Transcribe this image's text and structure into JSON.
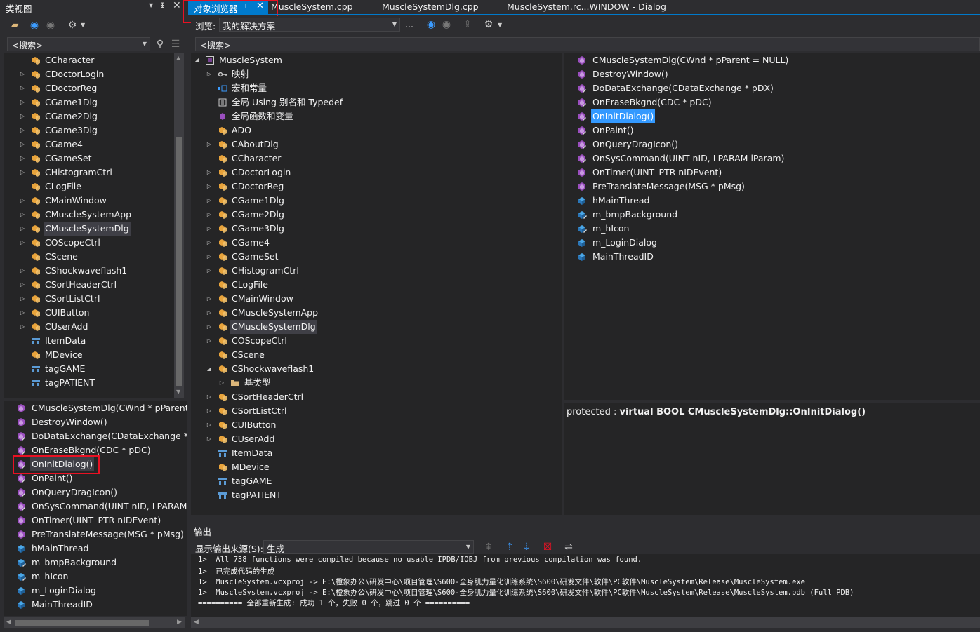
{
  "left": {
    "title": "类视图",
    "search_placeholder": "<搜索>",
    "classes": [
      {
        "label": "CCharacter",
        "icon": "class-icon",
        "arrow": false
      },
      {
        "label": "CDoctorLogin",
        "icon": "class-icon",
        "arrow": true
      },
      {
        "label": "CDoctorReg",
        "icon": "class-icon",
        "arrow": true
      },
      {
        "label": "CGame1Dlg",
        "icon": "class-icon",
        "arrow": true
      },
      {
        "label": "CGame2Dlg",
        "icon": "class-icon",
        "arrow": true
      },
      {
        "label": "CGame3Dlg",
        "icon": "class-icon",
        "arrow": true
      },
      {
        "label": "CGame4",
        "icon": "class-icon",
        "arrow": true
      },
      {
        "label": "CGameSet",
        "icon": "class-icon",
        "arrow": true
      },
      {
        "label": "CHistogramCtrl",
        "icon": "class-icon",
        "arrow": true
      },
      {
        "label": "CLogFile",
        "icon": "class-icon",
        "arrow": false
      },
      {
        "label": "CMainWindow",
        "icon": "class-icon",
        "arrow": true
      },
      {
        "label": "CMuscleSystemApp",
        "icon": "class-icon",
        "arrow": true
      },
      {
        "label": "CMuscleSystemDlg",
        "icon": "class-icon",
        "arrow": true,
        "selected": true
      },
      {
        "label": "COScopeCtrl",
        "icon": "class-icon",
        "arrow": true
      },
      {
        "label": "CScene",
        "icon": "class-icon",
        "arrow": false
      },
      {
        "label": "CShockwaveflash1",
        "icon": "class-icon",
        "arrow": true
      },
      {
        "label": "CSortHeaderCtrl",
        "icon": "class-icon",
        "arrow": true
      },
      {
        "label": "CSortListCtrl",
        "icon": "class-icon",
        "arrow": true
      },
      {
        "label": "CUIButton",
        "icon": "class-icon",
        "arrow": true
      },
      {
        "label": "CUserAdd",
        "icon": "class-icon",
        "arrow": true
      },
      {
        "label": "ItemData",
        "icon": "struct-icon",
        "arrow": false
      },
      {
        "label": "MDevice",
        "icon": "class-icon",
        "arrow": false
      },
      {
        "label": "tagGAME",
        "icon": "struct-icon",
        "arrow": false
      },
      {
        "label": "tagPATIENT",
        "icon": "struct-icon",
        "arrow": false
      }
    ],
    "members": [
      {
        "label": "CMuscleSystemDlg(CWnd * pParent = NULL)",
        "icon": "method-public-icon"
      },
      {
        "label": "DestroyWindow()",
        "icon": "method-public-icon"
      },
      {
        "label": "DoDataExchange(CDataExchange * pDX)",
        "icon": "method-protected-icon"
      },
      {
        "label": "OnEraseBkgnd(CDC * pDC)",
        "icon": "method-protected-icon"
      },
      {
        "label": "OnInitDialog()",
        "icon": "method-protected-icon",
        "selected": true
      },
      {
        "label": "OnPaint()",
        "icon": "method-protected-icon"
      },
      {
        "label": "OnQueryDragIcon()",
        "icon": "method-protected-icon"
      },
      {
        "label": "OnSysCommand(UINT nID, LPARAM lParam)",
        "icon": "method-protected-icon"
      },
      {
        "label": "OnTimer(UINT_PTR nIDEvent)",
        "icon": "method-public-icon"
      },
      {
        "label": "PreTranslateMessage(MSG * pMsg)",
        "icon": "method-public-icon"
      },
      {
        "label": "hMainThread",
        "icon": "field-icon"
      },
      {
        "label": "m_bmpBackground",
        "icon": "field-protected-icon"
      },
      {
        "label": "m_hIcon",
        "icon": "field-protected-icon"
      },
      {
        "label": "m_LoginDialog",
        "icon": "field-icon"
      },
      {
        "label": "MainThreadID",
        "icon": "field-icon"
      }
    ]
  },
  "tabs": [
    {
      "label": "对象浏览器",
      "active": true
    },
    {
      "label": "MuscleSystem.cpp"
    },
    {
      "label": "MuscleSystemDlg.cpp"
    },
    {
      "label": "MuscleSystem.rc...WINDOW - Dialog"
    }
  ],
  "browser": {
    "browse_label": "浏览:",
    "browse_value": "我的解决方案",
    "browse_more": "...",
    "search_placeholder": "<搜索>",
    "tree": [
      {
        "label": "MuscleSystem",
        "icon": "project-icon",
        "level": 0,
        "arrow": "open"
      },
      {
        "label": "映射",
        "icon": "map-icon",
        "level": 1,
        "arrow": "closed"
      },
      {
        "label": "宏和常量",
        "icon": "macro-icon",
        "level": 1,
        "arrow": ""
      },
      {
        "label": "全局 Using 别名和 Typedef",
        "icon": "typedef-icon",
        "level": 1,
        "arrow": ""
      },
      {
        "label": "全局函数和变量",
        "icon": "global-icon",
        "level": 1,
        "arrow": ""
      },
      {
        "label": "ADO",
        "icon": "class-icon",
        "level": 1,
        "arrow": ""
      },
      {
        "label": "CAboutDlg",
        "icon": "class-icon",
        "level": 1,
        "arrow": "closed"
      },
      {
        "label": "CCharacter",
        "icon": "class-icon",
        "level": 1,
        "arrow": ""
      },
      {
        "label": "CDoctorLogin",
        "icon": "class-icon",
        "level": 1,
        "arrow": "closed"
      },
      {
        "label": "CDoctorReg",
        "icon": "class-icon",
        "level": 1,
        "arrow": "closed"
      },
      {
        "label": "CGame1Dlg",
        "icon": "class-icon",
        "level": 1,
        "arrow": "closed"
      },
      {
        "label": "CGame2Dlg",
        "icon": "class-icon",
        "level": 1,
        "arrow": "closed"
      },
      {
        "label": "CGame3Dlg",
        "icon": "class-icon",
        "level": 1,
        "arrow": "closed"
      },
      {
        "label": "CGame4",
        "icon": "class-icon",
        "level": 1,
        "arrow": "closed"
      },
      {
        "label": "CGameSet",
        "icon": "class-icon",
        "level": 1,
        "arrow": "closed"
      },
      {
        "label": "CHistogramCtrl",
        "icon": "class-icon",
        "level": 1,
        "arrow": "closed"
      },
      {
        "label": "CLogFile",
        "icon": "class-icon",
        "level": 1,
        "arrow": ""
      },
      {
        "label": "CMainWindow",
        "icon": "class-icon",
        "level": 1,
        "arrow": "closed"
      },
      {
        "label": "CMuscleSystemApp",
        "icon": "class-icon",
        "level": 1,
        "arrow": "closed"
      },
      {
        "label": "CMuscleSystemDlg",
        "icon": "class-icon",
        "level": 1,
        "arrow": "closed",
        "selected": true
      },
      {
        "label": "COScopeCtrl",
        "icon": "class-icon",
        "level": 1,
        "arrow": "closed"
      },
      {
        "label": "CScene",
        "icon": "class-icon",
        "level": 1,
        "arrow": ""
      },
      {
        "label": "CShockwaveflash1",
        "icon": "class-icon",
        "level": 1,
        "arrow": "open"
      },
      {
        "label": "基类型",
        "icon": "folder-icon",
        "level": 2,
        "arrow": "closed"
      },
      {
        "label": "CSortHeaderCtrl",
        "icon": "class-icon",
        "level": 1,
        "arrow": "closed"
      },
      {
        "label": "CSortListCtrl",
        "icon": "class-icon",
        "level": 1,
        "arrow": "closed"
      },
      {
        "label": "CUIButton",
        "icon": "class-icon",
        "level": 1,
        "arrow": "closed"
      },
      {
        "label": "CUserAdd",
        "icon": "class-icon",
        "level": 1,
        "arrow": "closed"
      },
      {
        "label": "ItemData",
        "icon": "struct-icon",
        "level": 1,
        "arrow": ""
      },
      {
        "label": "MDevice",
        "icon": "class-icon",
        "level": 1,
        "arrow": ""
      },
      {
        "label": "tagGAME",
        "icon": "struct-icon",
        "level": 1,
        "arrow": ""
      },
      {
        "label": "tagPATIENT",
        "icon": "struct-icon",
        "level": 1,
        "arrow": ""
      }
    ],
    "members": [
      {
        "label": "CMuscleSystemDlg(CWnd * pParent = NULL)",
        "icon": "method-public-icon"
      },
      {
        "label": "DestroyWindow()",
        "icon": "method-public-icon"
      },
      {
        "label": "DoDataExchange(CDataExchange * pDX)",
        "icon": "method-protected-icon"
      },
      {
        "label": "OnEraseBkgnd(CDC * pDC)",
        "icon": "method-protected-icon"
      },
      {
        "label": "OnInitDialog()",
        "icon": "method-protected-icon",
        "selected": true
      },
      {
        "label": "OnPaint()",
        "icon": "method-protected-icon"
      },
      {
        "label": "OnQueryDragIcon()",
        "icon": "method-protected-icon"
      },
      {
        "label": "OnSysCommand(UINT nID, LPARAM lParam)",
        "icon": "method-protected-icon"
      },
      {
        "label": "OnTimer(UINT_PTR nIDEvent)",
        "icon": "method-public-icon"
      },
      {
        "label": "PreTranslateMessage(MSG * pMsg)",
        "icon": "method-public-icon"
      },
      {
        "label": "hMainThread",
        "icon": "field-icon"
      },
      {
        "label": "m_bmpBackground",
        "icon": "field-protected-icon"
      },
      {
        "label": "m_hIcon",
        "icon": "field-protected-icon"
      },
      {
        "label": "m_LoginDialog",
        "icon": "field-icon"
      },
      {
        "label": "MainThreadID",
        "icon": "field-icon"
      }
    ],
    "description_prefix": "protected : ",
    "description_signature": "virtual BOOL CMuscleSystemDlg::OnInitDialog()"
  },
  "output": {
    "title": "输出",
    "source_label": "显示输出来源(S):",
    "source_value": "生成",
    "lines": [
      "1>  All 738 functions were compiled because no usable IPDB/IOBJ from previous compilation was found.",
      "1>  已完成代码的生成",
      "1>  MuscleSystem.vcxproj -> E:\\橙象办公\\研发中心\\项目管理\\S600-全身肌力量化训练系统\\S600\\研发文件\\软件\\PC软件\\MuscleSystem\\Release\\MuscleSystem.exe",
      "1>  MuscleSystem.vcxproj -> E:\\橙象办公\\研发中心\\项目管理\\S600-全身肌力量化训练系统\\S600\\研发文件\\软件\\PC软件\\MuscleSystem\\Release\\MuscleSystem.pdb (Full PDB)",
      "========== 全部重新生成: 成功 1 个，失败 0 个，跳过 0 个 =========="
    ]
  },
  "colors": {
    "accent": "#007acc",
    "selection": "#3399ff",
    "highlight_box": "#e81123"
  }
}
